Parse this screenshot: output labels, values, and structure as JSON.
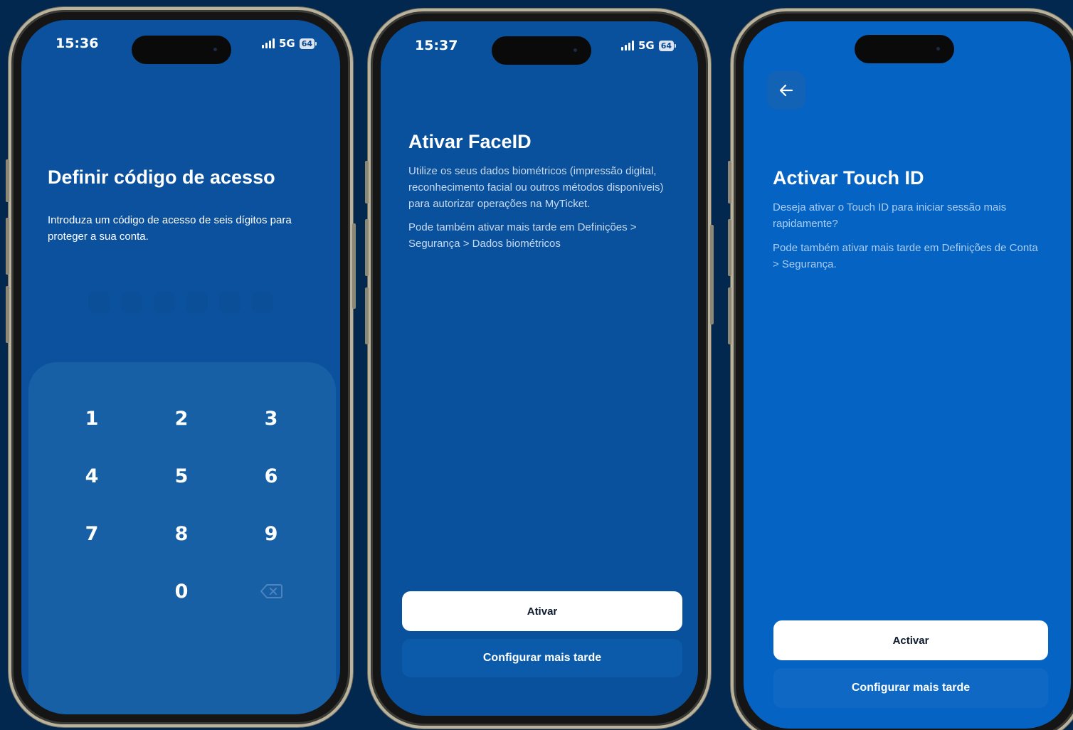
{
  "colors": {
    "background": "#03284f",
    "screen1_bg": "#0b519d",
    "screen2_bg": "#0a519d",
    "screen3_bg": "#0563c4",
    "keypad_bg": "#1760a6",
    "primary_button": "#ffffff",
    "secondary_button_2": "#0c5aaa",
    "secondary_button_3": "#0f68c3"
  },
  "screens": [
    {
      "status": {
        "time": "15:36",
        "network": "5G",
        "battery": "64"
      },
      "title": "Definir código de acesso",
      "description": "Introduza um código de acesso de seis dígitos para proteger a sua conta.",
      "pin_length": 6,
      "keypad": {
        "keys": [
          "1",
          "2",
          "3",
          "4",
          "5",
          "6",
          "7",
          "8",
          "9",
          "0"
        ],
        "delete_icon": "backspace-icon"
      }
    },
    {
      "status": {
        "time": "15:37",
        "network": "5G",
        "battery": "64"
      },
      "title": "Ativar FaceID",
      "description": "Utilize os seus dados biométricos (impressão digital, reconhecimento facial ou outros métodos disponíveis) para autorizar operações na MyTicket.",
      "note": "Pode também ativar mais tarde em Definições > Segurança > Dados biométricos",
      "primary_label": "Ativar",
      "secondary_label": "Configurar mais tarde"
    },
    {
      "back_icon": "arrow-left-icon",
      "title": "Activar Touch ID",
      "description": "Deseja ativar o Touch ID para iniciar sessão mais rapidamente?",
      "note": "Pode também ativar mais tarde em Definições de Conta > Segurança.",
      "primary_label": "Activar",
      "secondary_label": "Configurar mais tarde"
    }
  ]
}
